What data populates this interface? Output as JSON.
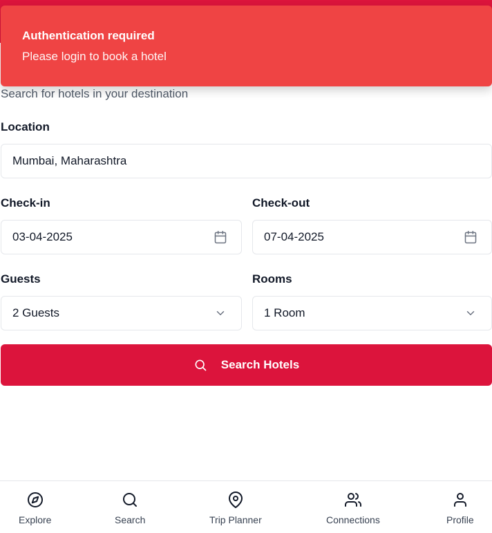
{
  "toast": {
    "title": "Authentication required",
    "message": "Please login to book a hotel"
  },
  "page": {
    "subtitle": "Search for hotels in your destination"
  },
  "form": {
    "location": {
      "label": "Location",
      "value": "Mumbai, Maharashtra"
    },
    "checkin": {
      "label": "Check-in",
      "value": "03-04-2025",
      "icon": "calendar-icon"
    },
    "checkout": {
      "label": "Check-out",
      "value": "07-04-2025",
      "icon": "calendar-icon"
    },
    "guests": {
      "label": "Guests",
      "value": "2 Guests",
      "icon": "chevron-down-icon"
    },
    "rooms": {
      "label": "Rooms",
      "value": "1 Room",
      "icon": "chevron-down-icon"
    },
    "search_button": {
      "label": "Search Hotels",
      "icon": "search-icon"
    }
  },
  "nav": {
    "items": [
      {
        "label": "Explore",
        "icon": "compass-icon"
      },
      {
        "label": "Search",
        "icon": "search-icon"
      },
      {
        "label": "Trip Planner",
        "icon": "map-pin-icon"
      },
      {
        "label": "Connections",
        "icon": "users-icon"
      },
      {
        "label": "Profile",
        "icon": "user-icon"
      }
    ]
  },
  "colors": {
    "brand": "#dc143c",
    "toast_bg": "#ef4444",
    "border": "#e5e7eb"
  }
}
